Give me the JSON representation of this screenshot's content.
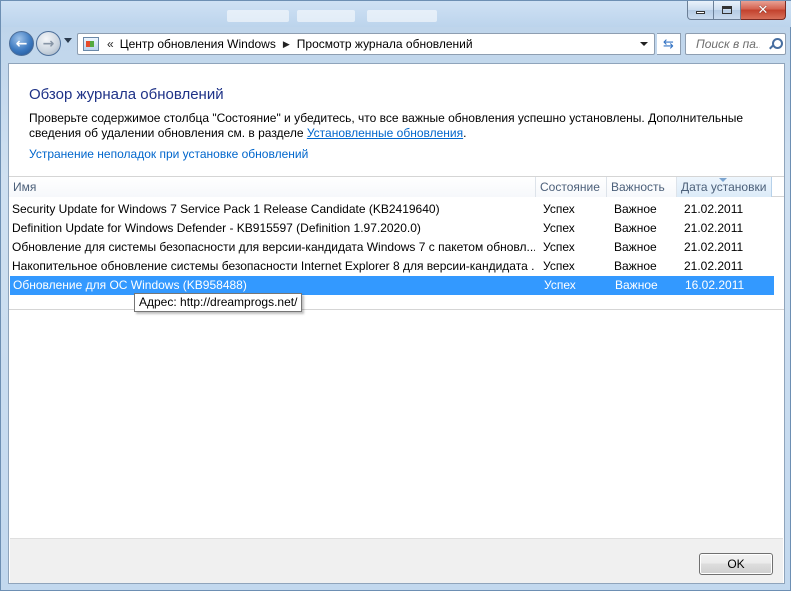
{
  "window": {
    "controls": {
      "minimize_icon": "minimize-icon",
      "maximize_icon": "maximize-icon",
      "close_icon": "close-icon"
    }
  },
  "nav": {
    "back_icon": "back-arrow-icon",
    "forward_icon": "forward-arrow-icon",
    "overflow": "«",
    "breadcrumbs": [
      "Центр обновления Windows",
      "Просмотр журнала обновлений"
    ],
    "search_placeholder": "Поиск в па..."
  },
  "page": {
    "title": "Обзор журнала обновлений",
    "intro_text": "Проверьте содержимое столбца \"Состояние\" и убедитесь, что все важные обновления успешно установлены. Дополнительные сведения об удалении обновления см. в разделе ",
    "intro_link": "Установленные обновления",
    "intro_end": ".",
    "troubleshoot_link": "Устранение неполадок при установке обновлений"
  },
  "list": {
    "columns": [
      "Имя",
      "Состояние",
      "Важность",
      "Дата установки"
    ],
    "sorted_column": "Дата установки",
    "rows": [
      {
        "name": "Security Update for Windows 7 Service Pack 1 Release Candidate (KB2419640)",
        "status": "Успех",
        "importance": "Важное",
        "date": "21.02.2011"
      },
      {
        "name": "Definition Update for Windows Defender - KB915597 (Definition 1.97.2020.0)",
        "status": "Успех",
        "importance": "Важное",
        "date": "21.02.2011"
      },
      {
        "name": "Обновление для системы безопасности для версии-кандидата Windows 7 с пакетом обновл...",
        "status": "Успех",
        "importance": "Важное",
        "date": "21.02.2011"
      },
      {
        "name": "Накопительное обновление системы безопасности Internet Explorer 8 для версии-кандидата ...",
        "status": "Успех",
        "importance": "Важное",
        "date": "21.02.2011"
      },
      {
        "name": "Обновление для ОС Windows (KB958488)",
        "status": "Успех",
        "importance": "Важное",
        "date": "16.02.2011",
        "selected": true
      }
    ]
  },
  "tooltip": {
    "text": "Адрес: http://dreamprogs.net/"
  },
  "footer": {
    "ok_label": "OK"
  },
  "colors": {
    "selection": "#3399ff",
    "title": "#1e3287",
    "link": "#0066cc"
  }
}
